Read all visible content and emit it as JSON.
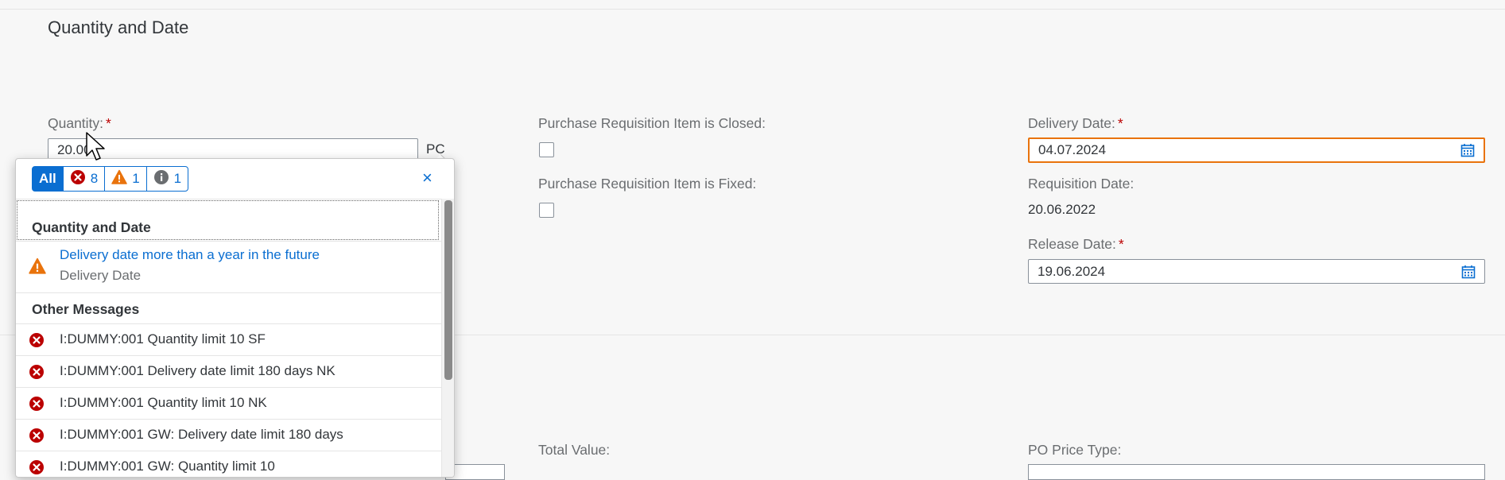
{
  "section": {
    "title": "Quantity and Date"
  },
  "fields": {
    "quantity_label": "Quantity:",
    "quantity_value": "20.00",
    "quantity_unit": "PC",
    "pr_closed_label": "Purchase Requisition Item is Closed:",
    "pr_fixed_label": "Purchase Requisition Item is Fixed:",
    "delivery_date_label": "Delivery Date:",
    "delivery_date_value": "04.07.2024",
    "requisition_date_label": "Requisition Date:",
    "requisition_date_value": "20.06.2022",
    "release_date_label": "Release Date:",
    "release_date_value": "19.06.2024",
    "required_mark": "*"
  },
  "lower": {
    "total_value_label": "Total Value:",
    "po_price_type_label": "PO Price Type:"
  },
  "popover": {
    "filters": {
      "all": "All",
      "error_count": "8",
      "warning_count": "1",
      "info_count": "1"
    },
    "close_label": "×",
    "groups": [
      {
        "header": "Quantity and Date",
        "messages": [
          {
            "type": "warning",
            "title": "Delivery date more than a year in the future",
            "subtitle": "Delivery Date"
          }
        ]
      },
      {
        "header": "Other Messages",
        "messages": [
          {
            "type": "error",
            "title": "I:DUMMY:001 Quantity limit 10 SF"
          },
          {
            "type": "error",
            "title": "I:DUMMY:001 Delivery date limit 180 days NK"
          },
          {
            "type": "error",
            "title": "I:DUMMY:001 Quantity limit 10 NK"
          },
          {
            "type": "error",
            "title": "I:DUMMY:001 GW: Delivery date limit 180 days"
          },
          {
            "type": "error",
            "title": "I:DUMMY:001 GW: Quantity limit 10"
          }
        ]
      }
    ]
  },
  "colors": {
    "accent": "#0a6ed1",
    "error": "#bb0000",
    "warning": "#e9730c",
    "info": "#6a6d70"
  }
}
